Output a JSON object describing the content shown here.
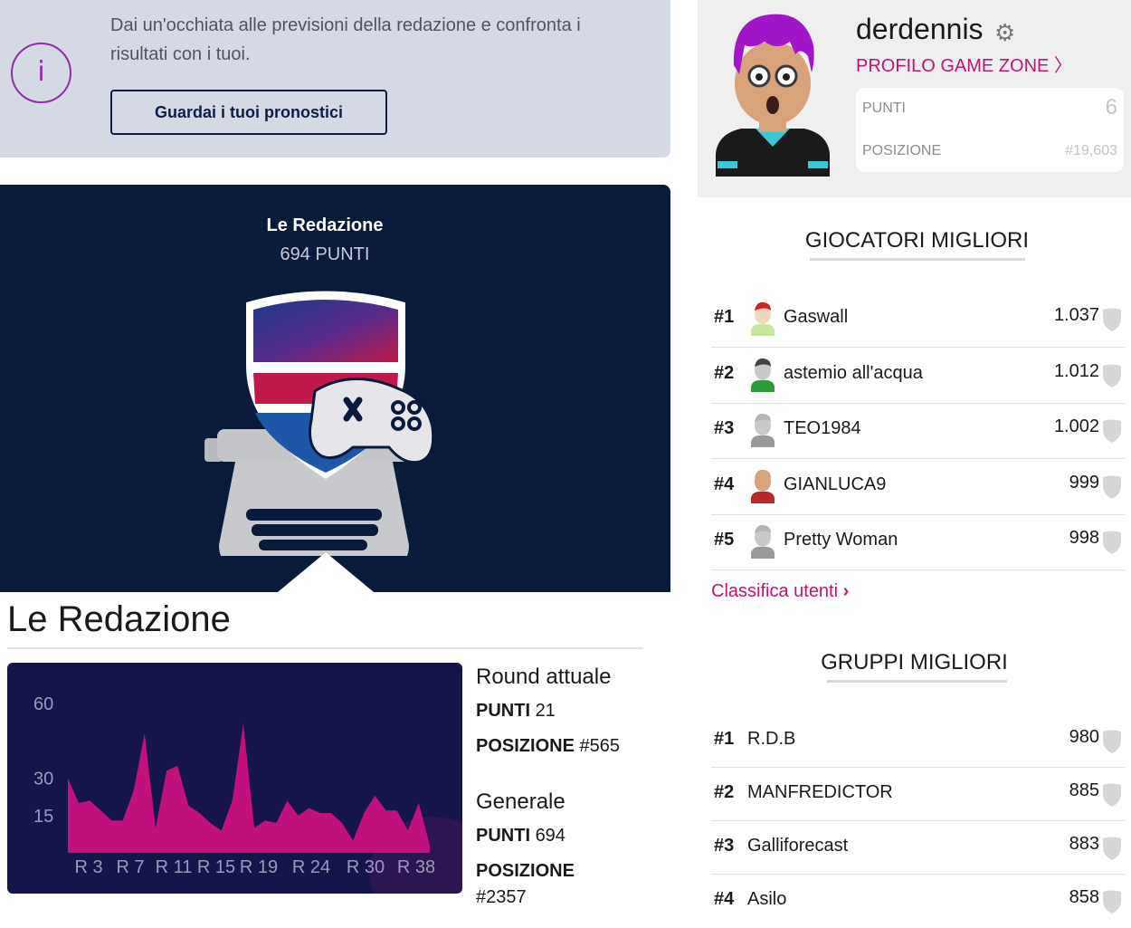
{
  "info_banner": {
    "text": "Dai un'occhiata alle previsioni della redazione e confronta i risultati con i tuoi.",
    "button_label": "Guardai i tuoi pronostici"
  },
  "hero": {
    "name": "Le Redazione",
    "points": "694 PUNTI"
  },
  "page_title": "Le Redazione",
  "chart_data": {
    "type": "area",
    "x": [
      "R 3",
      "R 7",
      "R 11",
      "R 15",
      "R 19",
      "R 24",
      "R 30",
      "R 38"
    ],
    "y_ticks": [
      "60",
      "30",
      "15"
    ],
    "ylim": [
      0,
      70
    ],
    "values": [
      30,
      20,
      21,
      17,
      13,
      13,
      25,
      48,
      10,
      33,
      35,
      19,
      16,
      12,
      9,
      21,
      52,
      10,
      13,
      12,
      21,
      15,
      18,
      16,
      16,
      12,
      5,
      16,
      23,
      17,
      17,
      9,
      20,
      3
    ],
    "colors": {
      "area": "#c0127a",
      "background": "#15154a",
      "ticks": "#9a9ab8"
    }
  },
  "stats": {
    "current_round": {
      "heading": "Round attuale",
      "points_label": "PUNTI",
      "points_value": "21",
      "position_label": "POSIZIONE",
      "position_value": "#565"
    },
    "overall": {
      "heading": "Generale",
      "points_label": "PUNTI",
      "points_value": "694",
      "position_label": "POSIZIONE",
      "position_value": "#2357"
    }
  },
  "profile": {
    "username": "derdennis",
    "link_label": "PROFILO GAME ZONE 〉",
    "points_label": "PUNTI",
    "points_value": "6",
    "position_label": "POSIZIONE",
    "position_value": "#19,603"
  },
  "top_players": {
    "title": "GIOCATORI MIGLIORI",
    "rows": [
      {
        "rank": "#1",
        "name": "Gaswall",
        "score": "1.037",
        "avatar": "cap-avatar-icon"
      },
      {
        "rank": "#2",
        "name": "astemio all'acqua",
        "score": "1.012",
        "avatar": "green-avatar-icon"
      },
      {
        "rank": "#3",
        "name": "TEO1984",
        "score": "1.002",
        "avatar": "grey-avatar-icon"
      },
      {
        "rank": "#4",
        "name": "GIANLUCA9",
        "score": "999",
        "avatar": "red-avatar-icon"
      },
      {
        "rank": "#5",
        "name": "Pretty Woman",
        "score": "998",
        "avatar": "grey-avatar-icon"
      }
    ],
    "link_label": "Classifica utenti"
  },
  "top_groups": {
    "title": "GRUPPI MIGLIORI",
    "rows": [
      {
        "rank": "#1",
        "name": "R.D.B",
        "score": "980"
      },
      {
        "rank": "#2",
        "name": "MANFREDICTOR",
        "score": "885"
      },
      {
        "rank": "#3",
        "name": "Galliforecast",
        "score": "883"
      },
      {
        "rank": "#4",
        "name": "Asilo",
        "score": "858"
      }
    ]
  },
  "colors": {
    "accent": "#c8136e",
    "navy": "#0a1a3a",
    "chart_bg": "#15154a",
    "info_bg": "#d5d9e3",
    "info_icon": "#8e2fa6"
  }
}
